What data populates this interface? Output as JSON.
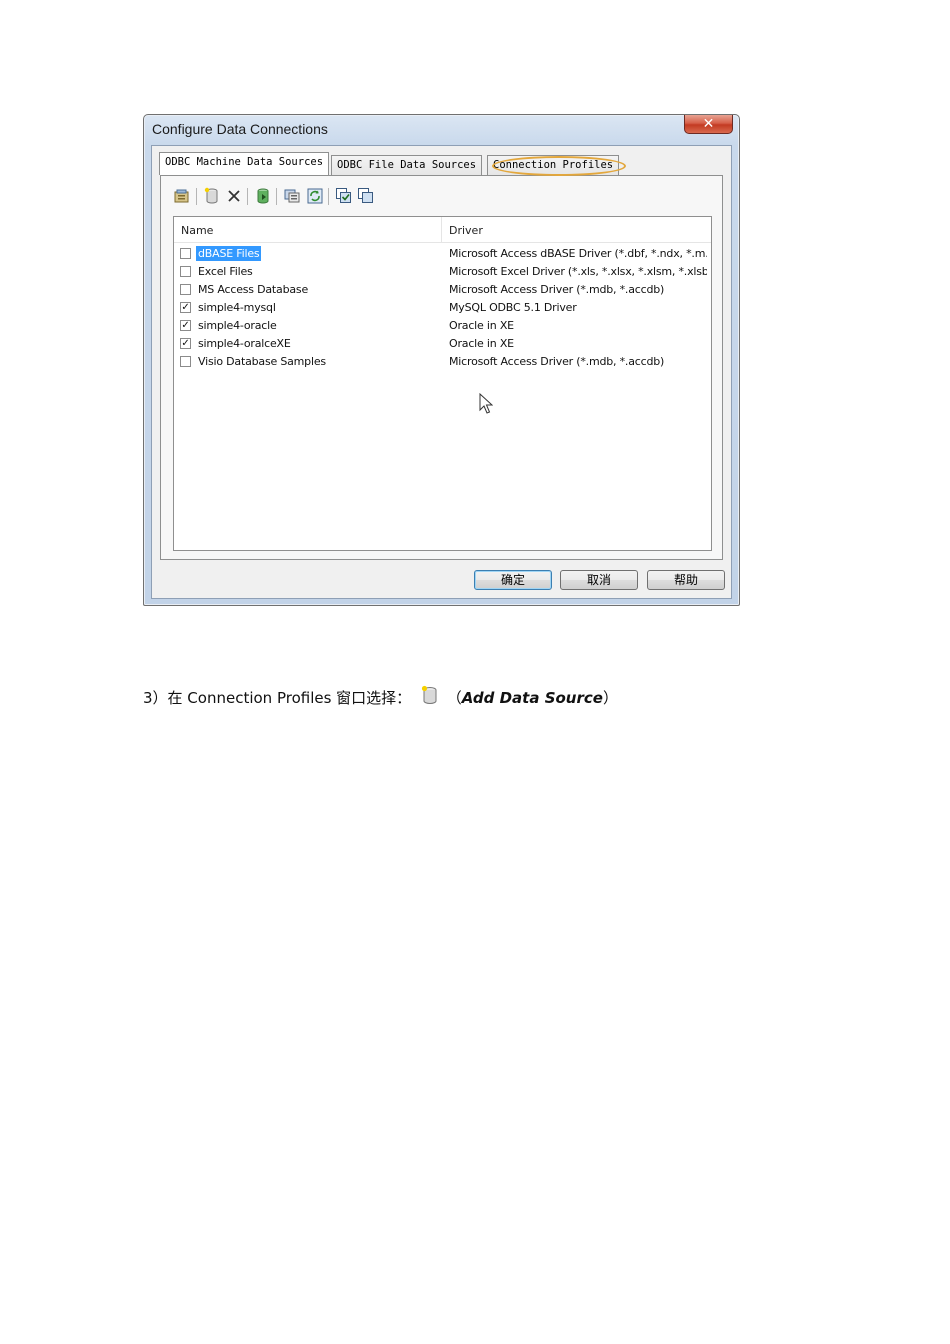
{
  "dialog": {
    "title": "Configure Data Connections",
    "close_glyph": "✕",
    "tabs": [
      {
        "label": "ODBC Machine Data Sources",
        "active": true
      },
      {
        "label": "ODBC File Data Sources",
        "active": false
      },
      {
        "label": "Connection Profiles",
        "active": false
      }
    ],
    "toolbar_icons": [
      "properties-icon",
      "add-data-source-icon",
      "delete-icon",
      "test-connection-icon",
      "odbc-admin-icon",
      "refresh-icon",
      "check-all-icon",
      "uncheck-all-icon"
    ],
    "list": {
      "columns": [
        "Name",
        "Driver"
      ],
      "rows": [
        {
          "name": "dBASE Files",
          "driver": "Microsoft Access dBASE Driver (*.dbf, *.ndx, *.m...",
          "checked": false,
          "selected": true
        },
        {
          "name": "Excel Files",
          "driver": "Microsoft Excel Driver (*.xls, *.xlsx, *.xlsm, *.xlsb)",
          "checked": false,
          "selected": false
        },
        {
          "name": "MS Access Database",
          "driver": "Microsoft Access Driver (*.mdb, *.accdb)",
          "checked": false,
          "selected": false
        },
        {
          "name": "simple4-mysql",
          "driver": "MySQL ODBC 5.1 Driver",
          "checked": true,
          "selected": false
        },
        {
          "name": "simple4-oracle",
          "driver": "Oracle in XE",
          "checked": true,
          "selected": false
        },
        {
          "name": "simple4-oralceXE",
          "driver": "Oracle in XE",
          "checked": true,
          "selected": false
        },
        {
          "name": "Visio Database Samples",
          "driver": "Microsoft Access Driver (*.mdb, *.accdb)",
          "checked": false,
          "selected": false
        }
      ]
    },
    "buttons": {
      "ok": "确定",
      "cancel": "取消",
      "help": "帮助"
    },
    "colors": {
      "highlight_ring": "#e3a73c",
      "selection": "#3399ff",
      "close_button": "#c33a22"
    }
  },
  "caption": {
    "prefix": "3）在 Connection Profiles 窗口选择：",
    "icon": "add-data-source-icon",
    "open_paren": "（",
    "emphasis": "Add Data Source",
    "close_paren": "）"
  }
}
